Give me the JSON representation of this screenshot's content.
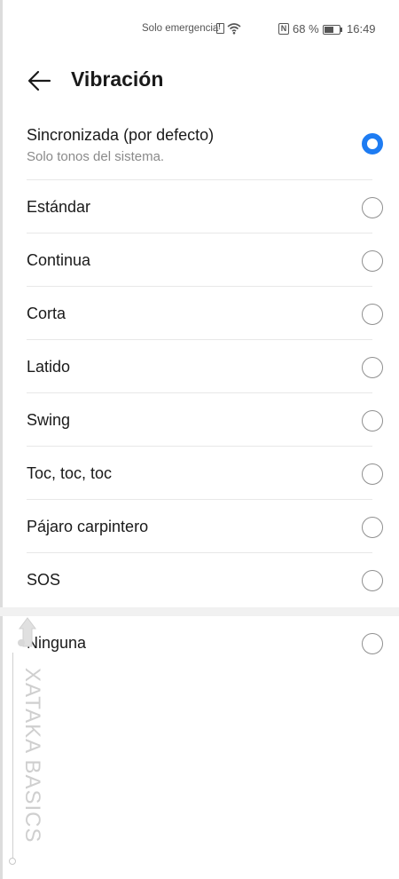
{
  "status_bar": {
    "emergency_text": "Solo emergencia",
    "battery_percent": "68 %",
    "battery_level": 0.68,
    "time": "16:49",
    "icons": [
      "sim-alert-icon",
      "wifi-icon",
      "nfc-icon",
      "battery-icon"
    ]
  },
  "header": {
    "title": "Vibración",
    "back_icon": "arrow-left-icon"
  },
  "options": [
    {
      "label": "Sincronizada (por defecto)",
      "sub": "Solo tonos del sistema.",
      "selected": true
    },
    {
      "label": "Estándar",
      "selected": false
    },
    {
      "label": "Continua",
      "selected": false
    },
    {
      "label": "Corta",
      "selected": false
    },
    {
      "label": "Latido",
      "selected": false
    },
    {
      "label": "Swing",
      "selected": false
    },
    {
      "label": "Toc, toc, toc",
      "selected": false
    },
    {
      "label": "Pájaro carpintero",
      "selected": false
    },
    {
      "label": "SOS",
      "selected": false
    }
  ],
  "none_option": {
    "label": "Ninguna",
    "selected": false
  },
  "watermark": {
    "text": "XATAKA BASICS"
  },
  "colors": {
    "accent": "#1e7cf2",
    "divider": "#e8e8e8",
    "secondary_text": "#8a8a8a"
  }
}
